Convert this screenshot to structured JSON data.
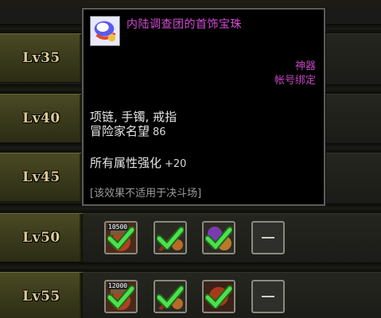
{
  "levels": [
    {
      "label": "Lv35"
    },
    {
      "label": "Lv40"
    },
    {
      "label": "Lv45"
    },
    {
      "label": "Lv50"
    },
    {
      "label": "Lv55"
    }
  ],
  "rows": {
    "lv50": {
      "slot1_number": "10500",
      "empty_slot": "—"
    },
    "lv55": {
      "slot1_number": "12000",
      "empty_slot": "—"
    }
  },
  "tooltip": {
    "title": "内陆调查团的首饰宝珠",
    "grade": "神器",
    "binding": "帐号绑定",
    "slots": "项链, 手镯, 戒指",
    "reputation_label": "冒险家名望",
    "reputation_value": "86",
    "stat_label": "所有属性强化",
    "stat_value": "+20",
    "note": "[该效果不适用于决斗场]"
  },
  "colors": {
    "title": "#d64ad6",
    "grade": "#c046c0",
    "level_bg": "#3f3f1f",
    "check": "#3fd23f"
  }
}
